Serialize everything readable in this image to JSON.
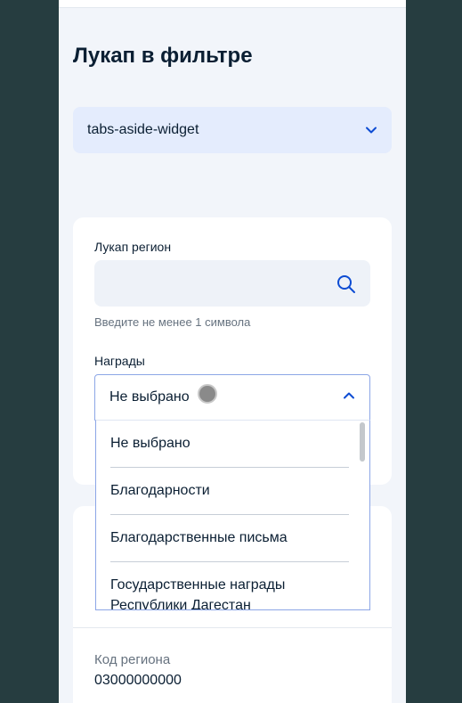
{
  "page": {
    "title": "Лукап в фильтре"
  },
  "tabs_select": {
    "value": "tabs-aside-widget",
    "icon": "chevron-down-icon"
  },
  "filter_card": {
    "region_lookup_label": "Лукап регион",
    "region_lookup_value": "",
    "region_lookup_hint": "Введите не менее 1 символа",
    "awards_label": "Награды",
    "awards_selected": "Не выбрано"
  },
  "awards_dropdown": {
    "options": [
      "Не выбрано",
      "Благодарности",
      "Благодарственные письма",
      "Государственные награды Республики Дагестан"
    ]
  },
  "result_card": {
    "region_code_label": "Код региона",
    "region_code_value": "03000000000"
  },
  "colors": {
    "background": "#263d40",
    "page": "#f2f5fa",
    "accent": "#0d4cd3",
    "select_bg": "#e4ecfd",
    "focus_border": "#8ca6e6"
  }
}
